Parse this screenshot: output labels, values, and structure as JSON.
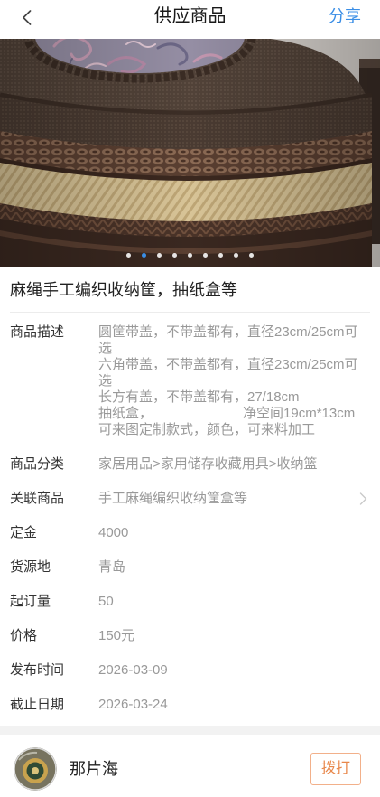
{
  "colors": {
    "accent": "#3a8ee6",
    "label": "#333333",
    "value": "#999999",
    "call": "#e8874a",
    "call_border": "#f2b08a"
  },
  "header": {
    "back_icon": "chevron-left-icon",
    "title": "供应商品",
    "share_label": "分享"
  },
  "gallery": {
    "total_images": 9,
    "active_index": 1
  },
  "product": {
    "title": "麻绳手工编织收纳筐，抽纸盒等"
  },
  "details": [
    {
      "label": "商品描述",
      "value": "圆筐带盖，不带盖都有，直径23cm/25cm可选\n六角带盖，不带盖都有，直径23cm/25cm可选\n长方有盖，不带盖都有，27/18cm\n抽纸盒，                        净空间19cm*13cm\n可来图定制款式，颜色，可来料加工"
    },
    {
      "label": "商品分类",
      "value": "家居用品>家用储存收藏用具>收纳篮"
    },
    {
      "label": "关联商品",
      "value": "手工麻绳编织收纳筐盒等",
      "icon": "chevron-right-icon"
    },
    {
      "label": "定金",
      "value": "4000"
    },
    {
      "label": "货源地",
      "value": "青岛"
    },
    {
      "label": "起订量",
      "value": "50"
    },
    {
      "label": "价格",
      "value": "150元"
    },
    {
      "label": "发布时间",
      "value": "2026-03-09"
    },
    {
      "label": "截止日期",
      "value": "2026-03-24"
    }
  ],
  "seller": {
    "avatar_icon": "avatar",
    "name": "那片海",
    "call_label": "拨打"
  }
}
